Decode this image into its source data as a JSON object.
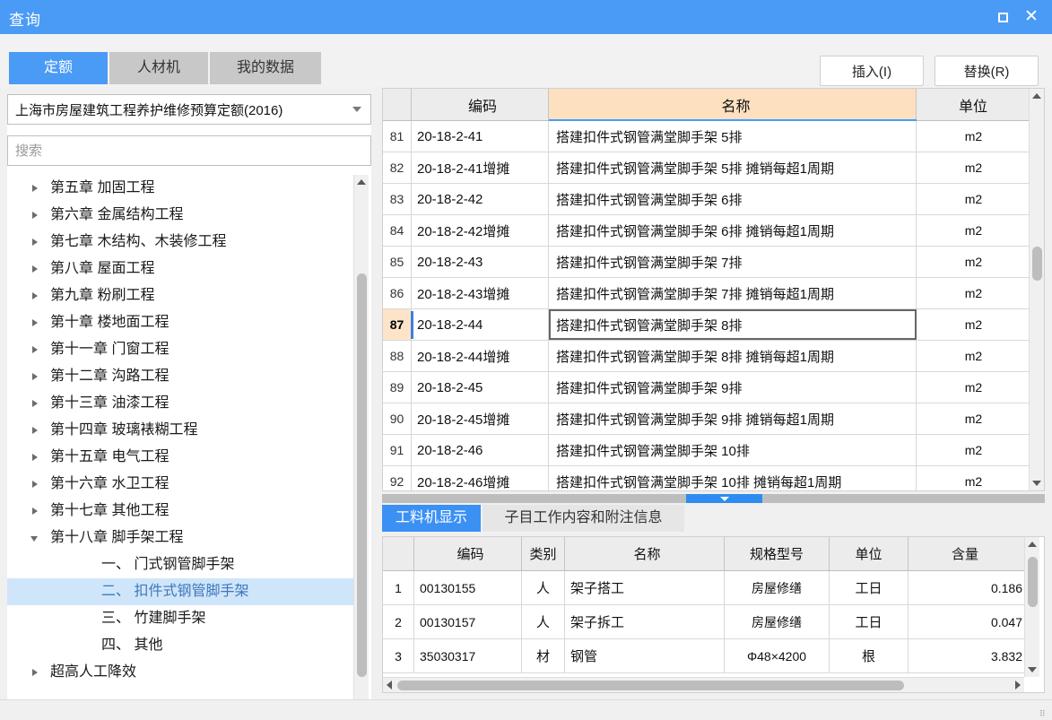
{
  "window": {
    "title": "查询",
    "maximize_icon": "maximize-icon",
    "close_icon": "close-icon",
    "close_glyph": "✕"
  },
  "toolbar": {
    "tabs": [
      {
        "label": "定额",
        "active": true
      },
      {
        "label": "人材机",
        "active": false
      },
      {
        "label": "我的数据",
        "active": false
      }
    ],
    "insert_label": "插入(I)",
    "replace_label": "替换(R)"
  },
  "sidebar": {
    "library_selected": "上海市房屋建筑工程养护维修预算定额(2016)",
    "search_placeholder": "搜索",
    "search_value": "",
    "tree": [
      {
        "label": "第五章 加固工程",
        "level": 1,
        "expander": "collapsed",
        "selected": false
      },
      {
        "label": "第六章 金属结构工程",
        "level": 1,
        "expander": "collapsed",
        "selected": false
      },
      {
        "label": "第七章 木结构、木装修工程",
        "level": 1,
        "expander": "collapsed",
        "selected": false
      },
      {
        "label": "第八章 屋面工程",
        "level": 1,
        "expander": "collapsed",
        "selected": false
      },
      {
        "label": "第九章 粉刷工程",
        "level": 1,
        "expander": "collapsed",
        "selected": false
      },
      {
        "label": "第十章 楼地面工程",
        "level": 1,
        "expander": "collapsed",
        "selected": false
      },
      {
        "label": "第十一章 门窗工程",
        "level": 1,
        "expander": "collapsed",
        "selected": false
      },
      {
        "label": "第十二章 沟路工程",
        "level": 1,
        "expander": "collapsed",
        "selected": false
      },
      {
        "label": "第十三章 油漆工程",
        "level": 1,
        "expander": "collapsed",
        "selected": false
      },
      {
        "label": "第十四章 玻璃裱糊工程",
        "level": 1,
        "expander": "collapsed",
        "selected": false
      },
      {
        "label": "第十五章 电气工程",
        "level": 1,
        "expander": "collapsed",
        "selected": false
      },
      {
        "label": "第十六章 水卫工程",
        "level": 1,
        "expander": "collapsed",
        "selected": false
      },
      {
        "label": "第十七章 其他工程",
        "level": 1,
        "expander": "collapsed",
        "selected": false
      },
      {
        "label": "第十八章 脚手架工程",
        "level": 1,
        "expander": "expanded",
        "selected": false
      },
      {
        "label": "一、 门式钢管脚手架",
        "level": 2,
        "expander": "none",
        "selected": false
      },
      {
        "label": "二、 扣件式钢管脚手架",
        "level": 2,
        "expander": "none",
        "selected": true
      },
      {
        "label": "三、 竹建脚手架",
        "level": 2,
        "expander": "none",
        "selected": false
      },
      {
        "label": "四、 其他",
        "level": 2,
        "expander": "none",
        "selected": false
      },
      {
        "label": "超高人工降效",
        "level": 1,
        "expander": "collapsed",
        "selected": false
      }
    ]
  },
  "main_table": {
    "columns": [
      "",
      "编码",
      "名称",
      "单位"
    ],
    "rows": [
      {
        "idx": "81",
        "code": "20-18-2-41",
        "name": "搭建扣件式钢管满堂脚手架 5排",
        "unit": "m2",
        "active": false
      },
      {
        "idx": "82",
        "code": "20-18-2-41增摊",
        "name": "搭建扣件式钢管满堂脚手架 5排 摊销每超1周期",
        "unit": "m2",
        "active": false
      },
      {
        "idx": "83",
        "code": "20-18-2-42",
        "name": "搭建扣件式钢管满堂脚手架 6排",
        "unit": "m2",
        "active": false
      },
      {
        "idx": "84",
        "code": "20-18-2-42增摊",
        "name": "搭建扣件式钢管满堂脚手架 6排 摊销每超1周期",
        "unit": "m2",
        "active": false
      },
      {
        "idx": "85",
        "code": "20-18-2-43",
        "name": "搭建扣件式钢管满堂脚手架 7排",
        "unit": "m2",
        "active": false
      },
      {
        "idx": "86",
        "code": "20-18-2-43增摊",
        "name": "搭建扣件式钢管满堂脚手架 7排 摊销每超1周期",
        "unit": "m2",
        "active": false
      },
      {
        "idx": "87",
        "code": "20-18-2-44",
        "name": "搭建扣件式钢管满堂脚手架 8排",
        "unit": "m2",
        "active": true
      },
      {
        "idx": "88",
        "code": "20-18-2-44增摊",
        "name": "搭建扣件式钢管满堂脚手架 8排 摊销每超1周期",
        "unit": "m2",
        "active": false
      },
      {
        "idx": "89",
        "code": "20-18-2-45",
        "name": "搭建扣件式钢管满堂脚手架 9排",
        "unit": "m2",
        "active": false
      },
      {
        "idx": "90",
        "code": "20-18-2-45增摊",
        "name": "搭建扣件式钢管满堂脚手架 9排 摊销每超1周期",
        "unit": "m2",
        "active": false
      },
      {
        "idx": "91",
        "code": "20-18-2-46",
        "name": "搭建扣件式钢管满堂脚手架 10排",
        "unit": "m2",
        "active": false
      },
      {
        "idx": "92",
        "code": "20-18-2-46增摊",
        "name": "搭建扣件式钢管满堂脚手架 10排 摊销每超1周期",
        "unit": "m2",
        "active": false
      }
    ]
  },
  "bottom_tabs": [
    {
      "label": "工料机显示",
      "active": true
    },
    {
      "label": "子目工作内容和附注信息",
      "active": false
    }
  ],
  "bottom_table": {
    "columns": [
      "",
      "编码",
      "类别",
      "名称",
      "规格型号",
      "单位",
      "含量"
    ],
    "rows": [
      {
        "idx": "1",
        "code": "00130155",
        "cat": "人",
        "name": "架子搭工",
        "spec": "房屋修缮",
        "unit": "工日",
        "qty": "0.186"
      },
      {
        "idx": "2",
        "code": "00130157",
        "cat": "人",
        "name": "架子拆工",
        "spec": "房屋修缮",
        "unit": "工日",
        "qty": "0.047"
      },
      {
        "idx": "3",
        "code": "35030317",
        "cat": "材",
        "name": "钢管",
        "spec": "Φ48×4200",
        "unit": "根",
        "qty": "3.832"
      }
    ]
  },
  "colors": {
    "accent": "#4a9bf5",
    "title_bar": "#4a9bf5",
    "name_header": "#fce0c0",
    "selected_row_idx": "#fde4c8",
    "tree_selected": "#cfe5fa"
  }
}
